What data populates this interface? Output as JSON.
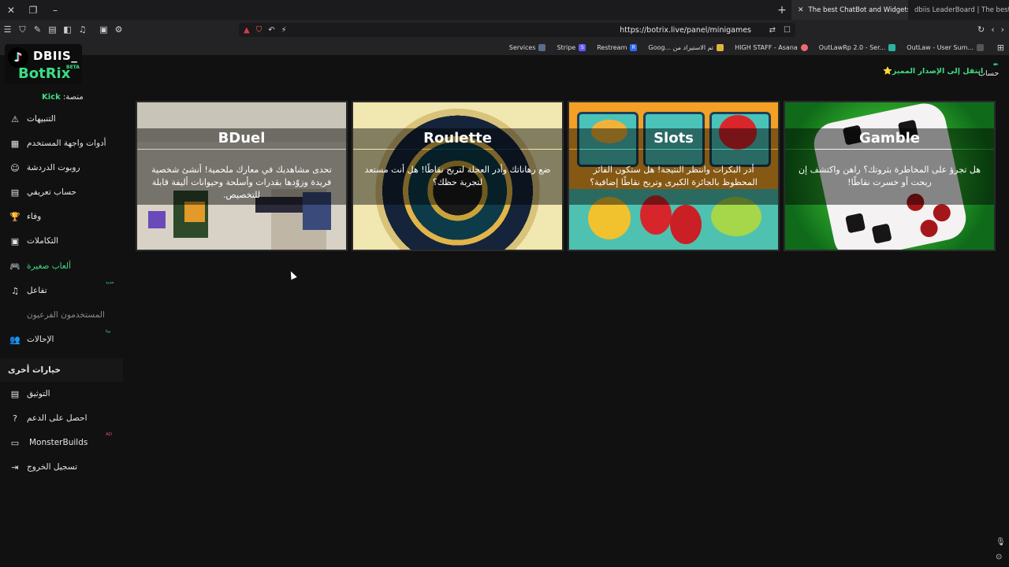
{
  "browser": {
    "tabs": [
      {
        "title": "The best ChatBot and Widgets f",
        "active": true
      },
      {
        "title": "dbiis LeaderBoard | The best ChatBot",
        "active": false
      }
    ],
    "new_tab": "+",
    "url": "https://botrix.live/panel/minigames",
    "bookmarks": [
      {
        "label": "Services",
        "color": "#3b82f6"
      },
      {
        "label": "Stripe",
        "color": "#635bff",
        "glyph": "S"
      },
      {
        "label": "Restream",
        "color": "#2d6bf0",
        "glyph": "R"
      },
      {
        "label": "Goog... تم الاستيراد من",
        "color": "#e2b33c"
      },
      {
        "label": "HIGH STAFF - Asana",
        "color": "#f06a6a"
      },
      {
        "label": "OutLawRp 2.0 - Ser...",
        "color": "#2bb3a0"
      },
      {
        "label": "OutLaw - User Sum...",
        "color": "#8a8a8a"
      }
    ]
  },
  "header": {
    "logo_user": "DBIIS_",
    "logo_brand": "BotRix",
    "logo_beta": "BETA",
    "premium_link": "انتقل إلى الإصدار المميز⭐",
    "account_label": "حساب"
  },
  "sidebar": {
    "platform_label": "منصة:",
    "platform_value": "Kick",
    "items": [
      {
        "label": "التنبيهات",
        "icon": "⚠",
        "name": "alerts",
        "badge": ""
      },
      {
        "label": "أدوات واجهة المستخدم",
        "icon": "▦",
        "name": "widgets",
        "badge": ""
      },
      {
        "label": "روبوت الدردشة",
        "icon": "☺",
        "name": "chatbot",
        "badge": ""
      },
      {
        "label": "حساب تعريفي",
        "icon": "▤",
        "name": "profile",
        "badge": ""
      },
      {
        "label": "وفاء",
        "icon": "🏆",
        "name": "loyalty",
        "badge": ""
      },
      {
        "label": "التكاملات",
        "icon": "▣",
        "name": "integrations",
        "badge": ""
      },
      {
        "label": "ألعاب صغيرة",
        "icon": "🎮",
        "name": "minigames",
        "badge": "",
        "active": true
      },
      {
        "label": "تفاعل",
        "icon": "♫",
        "name": "interaction",
        "badge": "جديد"
      },
      {
        "label": "المستخدمون الفرعيون",
        "icon": "",
        "name": "sub-users",
        "badge": "",
        "disabled": true
      },
      {
        "label": "الإحالات",
        "icon": "👥",
        "name": "referrals",
        "badge": "بيتا"
      }
    ],
    "other_options_title": "خيارات أخرى",
    "other_items": [
      {
        "label": "التوثيق",
        "icon": "▤",
        "name": "documentation",
        "badge": ""
      },
      {
        "label": "احصل على الدعم",
        "icon": "?",
        "name": "get-support",
        "badge": ""
      },
      {
        "label": "MonsterBuilds",
        "icon": "▭",
        "name": "monsterbuilds",
        "badge": "AD",
        "badge_color": "red"
      },
      {
        "label": "تسجيل الخروج",
        "icon": "⇥",
        "name": "logout",
        "badge": ""
      }
    ]
  },
  "games": [
    {
      "title": "BDuel",
      "description": "تحدى مشاهديك في معارك ملحمية! أنشئ شخصية فريدة وزوّدها بقدرات وأسلحة وحيوانات أليفة قابلة للتخصيص."
    },
    {
      "title": "Roulette",
      "description": "ضع رهاناتك وأدر العجلة لتربح نقاطًا! هل أنت مستعد لتجربة حظك؟"
    },
    {
      "title": "Slots",
      "description": "أدر البكرات وانتظر النتيجة! هل ستكون الفائز المحظوظ بالجائزة الكبرى وتربح نقاطًا إضافية؟"
    },
    {
      "title": "Gamble",
      "description": "هل تجرؤ على المخاطرة بثروتك؟ راهن واكتشف إن ربحت أو خسرت نقاطًا!"
    }
  ],
  "colors": {
    "accent": "#3ddc84",
    "background": "#111111"
  }
}
